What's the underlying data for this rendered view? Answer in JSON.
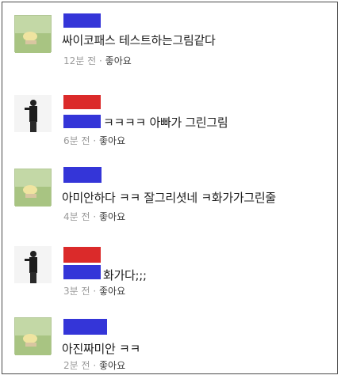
{
  "comments": [
    {
      "text": "싸이코패스 테스트하는그림같다",
      "time": "12분 전",
      "sep": "·",
      "like": "좋아요",
      "avatar": "landscape-avatar"
    },
    {
      "text": "ㅋㅋㅋㅋ 아빠가 그린그림",
      "time": "6분 전",
      "sep": "·",
      "like": "좋아요",
      "avatar": "person-avatar"
    },
    {
      "text": "아미안하다 ㅋㅋ 잘그리셧네 ㅋ화가가그린줄",
      "time": "4분 전",
      "sep": "·",
      "like": "좋아요",
      "avatar": "landscape-avatar"
    },
    {
      "text": "화가다;;;",
      "time": "3분 전",
      "sep": "·",
      "like": "좋아요",
      "avatar": "person-avatar"
    },
    {
      "text": "아진짜미안 ㅋㅋ",
      "time": "2분 전",
      "sep": "·",
      "like": "좋아요",
      "avatar": "landscape-avatar"
    }
  ],
  "colors": {
    "redact_blue": "#3435d8",
    "redact_red": "#db2a2a",
    "meta_gray": "#9a9a9a",
    "text": "#1d1d1d"
  }
}
